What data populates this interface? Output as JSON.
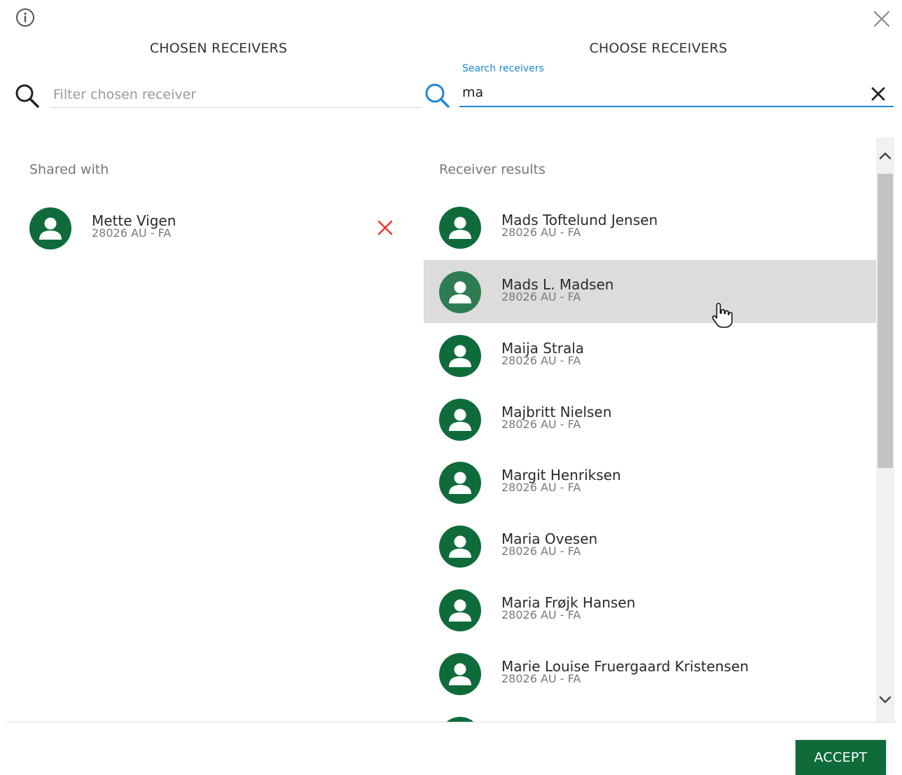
{
  "header": {
    "info_icon": "info-circle-icon",
    "close_icon": "close-icon"
  },
  "chosen": {
    "title": "CHOSEN RECEIVERS",
    "filter_placeholder": "Filter chosen receiver",
    "filter_value": "",
    "section_label": "Shared with",
    "items": [
      {
        "name": "Mette Vigen",
        "org": "28026 AU - FA"
      }
    ]
  },
  "choose": {
    "title": "CHOOSE RECEIVERS",
    "search_label": "Search receivers",
    "search_value": "ma",
    "section_label": "Receiver results",
    "items": [
      {
        "name": "Mads Toftelund Jensen",
        "org": "28026 AU - FA"
      },
      {
        "name": "Mads L. Madsen",
        "org": "28026 AU - FA"
      },
      {
        "name": "Maija Strala",
        "org": "28026 AU - FA"
      },
      {
        "name": "Majbritt Nielsen",
        "org": "28026 AU - FA"
      },
      {
        "name": "Margit Henriksen",
        "org": "28026 AU - FA"
      },
      {
        "name": "Maria Ovesen",
        "org": "28026 AU - FA"
      },
      {
        "name": "Maria Frøjk Hansen",
        "org": "28026 AU - FA"
      },
      {
        "name": "Marie Louise Fruergaard Kristensen",
        "org": "28026 AU - FA"
      },
      {
        "name": "",
        "org": ""
      }
    ],
    "hovered_index": 1
  },
  "footer": {
    "accept_label": "ACCEPT"
  },
  "colors": {
    "brand_green": "#0f6b3a",
    "search_blue": "#1e88d8",
    "remove_red": "#e53935",
    "hover_gray": "#dcdcdc"
  }
}
